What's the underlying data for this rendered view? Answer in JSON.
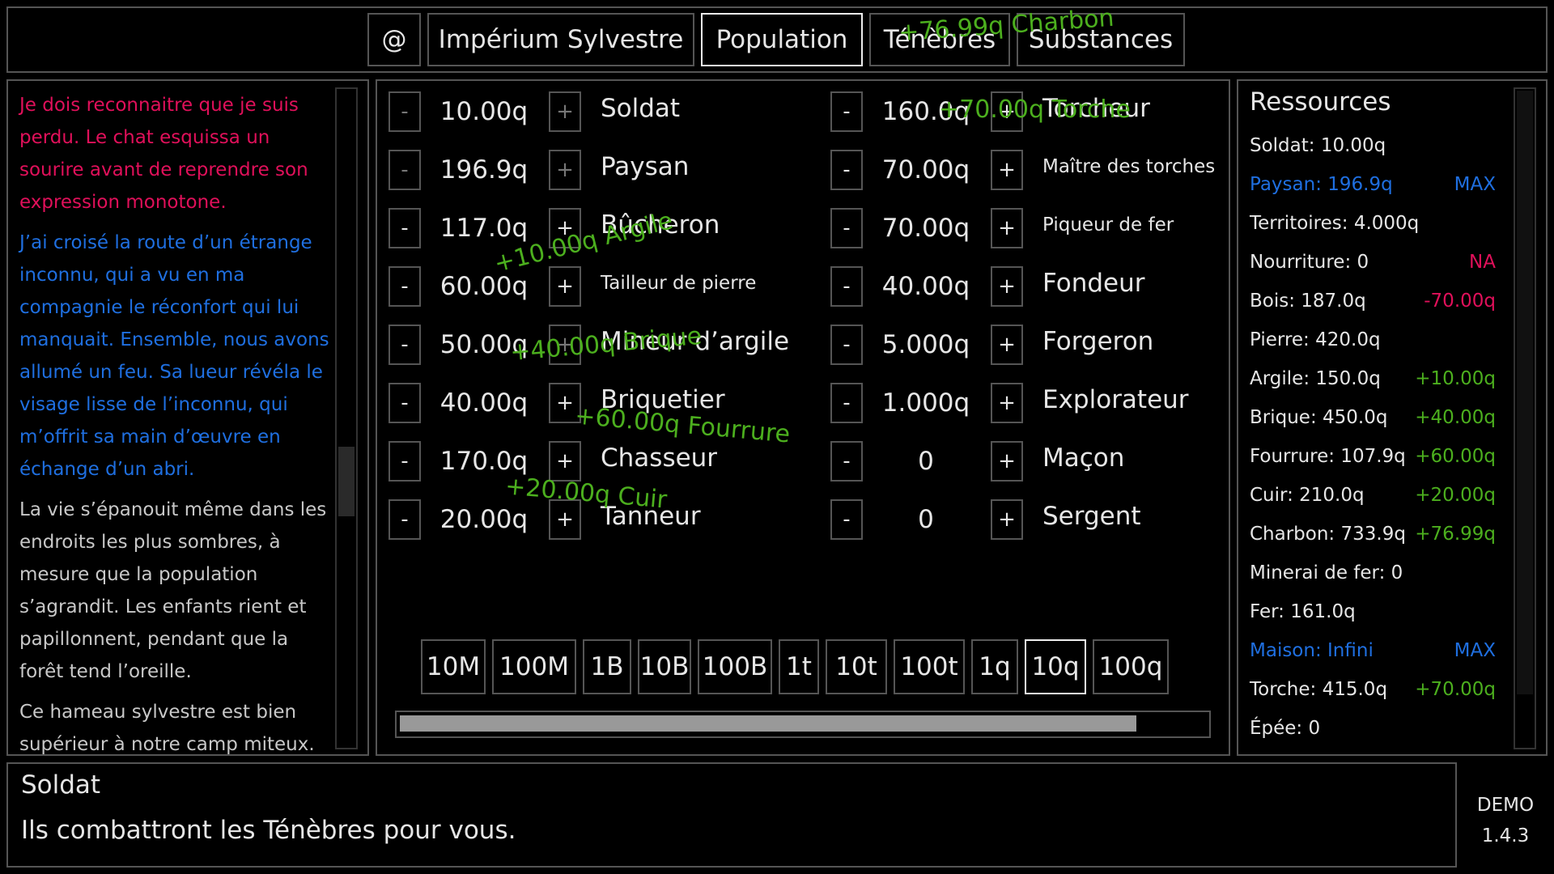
{
  "tabs": {
    "at": "@",
    "empire": "Impérium Sylvestre",
    "population": "Population",
    "tenebres": "Ténèbres",
    "substances": "Substances"
  },
  "log": {
    "paragraphs": [
      {
        "text": "Je dois reconnaitre que je suis perdu. Le chat esquissa un sourire avant de reprendre son expression monotone.",
        "color": "#e0105a"
      },
      {
        "text": "J’ai croisé la route d’un étrange inconnu, qui a vu en ma compagnie le réconfort qui lui manquait. Ensemble, nous avons allumé un feu. Sa lueur révéla le visage lisse de l’inconnu, qui m’offrit sa main d’œuvre en échange d’un abri.",
        "color": "#1f6fe0"
      },
      {
        "text": "La vie s’épanouit même dans les endroits les plus sombres, à mesure que la population s’agrandit. Les enfants rient et papillonnent, pendant que la forêt tend l’oreille.",
        "color": "#c8c8c8"
      },
      {
        "text": "Ce hameau sylvestre est bien supérieur à notre camp miteux.",
        "color": "#c8c8c8"
      }
    ]
  },
  "population": {
    "left": [
      {
        "qty": "10.00q",
        "name": "Soldat",
        "minus_dim": true,
        "plus_dim": true
      },
      {
        "qty": "196.9q",
        "name": "Paysan",
        "minus_dim": true,
        "plus_dim": true
      },
      {
        "qty": "117.0q",
        "name": "Bûcheron"
      },
      {
        "qty": "60.00q",
        "name": "Tailleur de pierre",
        "small": true
      },
      {
        "qty": "50.00q",
        "name": "Mineur d’argile",
        "plus_dim": true
      },
      {
        "qty": "40.00q",
        "name": "Briquetier"
      },
      {
        "qty": "170.0q",
        "name": "Chasseur"
      },
      {
        "qty": "20.00q",
        "name": "Tanneur"
      }
    ],
    "right": [
      {
        "qty": "160.0q",
        "name": "Torcheur"
      },
      {
        "qty": "70.00q",
        "name": "Maître des torches",
        "small": true
      },
      {
        "qty": "70.00q",
        "name": "Piqueur de fer",
        "small": true
      },
      {
        "qty": "40.00q",
        "name": "Fondeur"
      },
      {
        "qty": "5.000q",
        "name": "Forgeron"
      },
      {
        "qty": "1.000q",
        "name": "Explorateur"
      },
      {
        "qty": "0",
        "name": "Maçon"
      },
      {
        "qty": "0",
        "name": "Sergent"
      }
    ],
    "minus_label": "-",
    "plus_label": "+",
    "multipliers": [
      "10M",
      "100M",
      "1B",
      "10B",
      "100B",
      "1t",
      "10t",
      "100t",
      "1q",
      "10q",
      "100q"
    ],
    "selected_multiplier": "10q",
    "progress": 0.91,
    "floating_texts": [
      "+76.99q Charbon",
      "+70.00q Torche",
      "+10.00q Argile",
      "+40.00q Brique",
      "+60.00q Fourrure",
      "+20.00q Cuir"
    ]
  },
  "resources": {
    "title": "Ressources",
    "items": [
      {
        "label": "Soldat: 10.00q",
        "rate": "",
        "color": "#e6e6e6",
        "rate_color": "#e6e6e6"
      },
      {
        "label": "Paysan: 196.9q",
        "rate": "MAX",
        "color": "#1f6fe0",
        "rate_color": "#1f6fe0"
      },
      {
        "label": "Territoires: 4.000q",
        "rate": "",
        "color": "#e6e6e6",
        "rate_color": "#e6e6e6"
      },
      {
        "label": "Nourriture: 0",
        "rate": "NA",
        "color": "#e6e6e6",
        "rate_color": "#e0105a"
      },
      {
        "label": "Bois: 187.0q",
        "rate": "-70.00q",
        "color": "#e6e6e6",
        "rate_color": "#e0105a"
      },
      {
        "label": "Pierre: 420.0q",
        "rate": "",
        "color": "#e6e6e6",
        "rate_color": "#e6e6e6"
      },
      {
        "label": "Argile: 150.0q",
        "rate": "+10.00q",
        "color": "#e6e6e6",
        "rate_color": "#4caf1e"
      },
      {
        "label": "Brique: 450.0q",
        "rate": "+40.00q",
        "color": "#e6e6e6",
        "rate_color": "#4caf1e"
      },
      {
        "label": "Fourrure: 107.9q",
        "rate": "+60.00q",
        "color": "#e6e6e6",
        "rate_color": "#4caf1e"
      },
      {
        "label": "Cuir: 210.0q",
        "rate": "+20.00q",
        "color": "#e6e6e6",
        "rate_color": "#4caf1e"
      },
      {
        "label": "Charbon: 733.9q",
        "rate": "+76.99q",
        "color": "#e6e6e6",
        "rate_color": "#4caf1e"
      },
      {
        "label": "Minerai de fer: 0",
        "rate": "",
        "color": "#e6e6e6",
        "rate_color": "#e6e6e6"
      },
      {
        "label": "Fer: 161.0q",
        "rate": "",
        "color": "#e6e6e6",
        "rate_color": "#e6e6e6"
      },
      {
        "label": "Maison: Infini",
        "rate": "MAX",
        "color": "#1f6fe0",
        "rate_color": "#1f6fe0"
      },
      {
        "label": "Torche: 415.0q",
        "rate": "+70.00q",
        "color": "#e6e6e6",
        "rate_color": "#4caf1e"
      },
      {
        "label": "Épée: 0",
        "rate": "",
        "color": "#e6e6e6",
        "rate_color": "#e6e6e6"
      }
    ]
  },
  "description": {
    "title": "Soldat",
    "text": "Ils combattront les Ténèbres pour vous."
  },
  "version": {
    "label": "DEMO",
    "number": "1.4.3"
  },
  "colors": {
    "green": "#4caf1e",
    "blue": "#1f6fe0",
    "red": "#e0105a"
  }
}
